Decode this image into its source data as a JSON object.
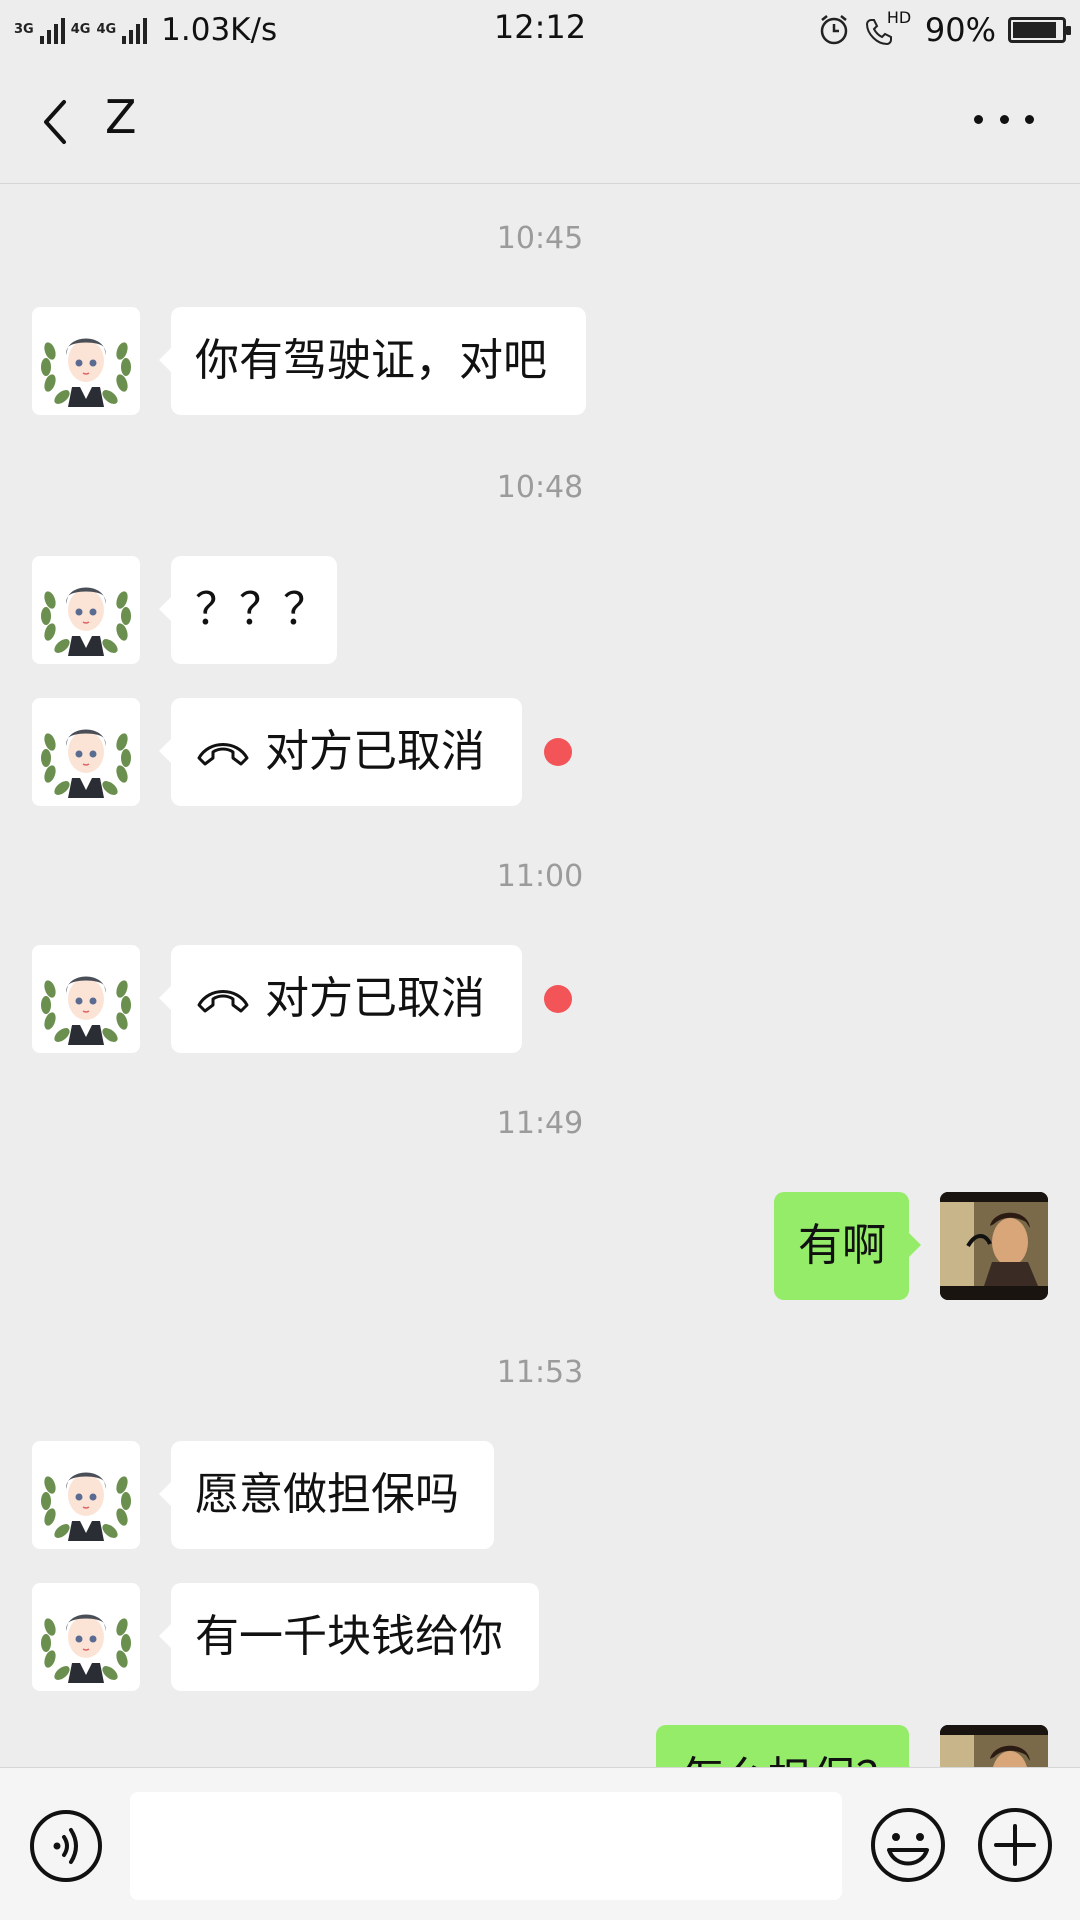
{
  "status_bar": {
    "network_1": "3G",
    "network_2": "4G",
    "network_3": "4G",
    "speed": "1.03K/s",
    "time": "12:12",
    "hd_label": "HD",
    "battery": "90%",
    "battery_level": 0.9
  },
  "header": {
    "title": "Z"
  },
  "messages": [
    {
      "timestamp": "10:45"
    },
    {
      "text": "你有驾驶证，对吧"
    },
    {
      "timestamp": "10:48"
    },
    {
      "text": "？？？"
    },
    {
      "text": "对方已取消"
    },
    {
      "timestamp": "11:00"
    },
    {
      "text": "对方已取消"
    },
    {
      "timestamp": "11:49"
    },
    {
      "text": "有啊"
    },
    {
      "timestamp": "11:53"
    },
    {
      "text": "愿意做担保吗"
    },
    {
      "text": "有一千块钱给你"
    },
    {
      "text": "怎么担保？"
    }
  ],
  "colors": {
    "background": "#ededed",
    "my_bubble": "#95ec69",
    "friend_bubble": "#ffffff",
    "unread_dot": "#f25457",
    "timestamp": "#9b9b9b"
  },
  "icons": [
    "back-chevron-icon",
    "more-dots-icon",
    "call-cancel-icon",
    "voice-icon",
    "emoji-icon",
    "plus-icon"
  ]
}
